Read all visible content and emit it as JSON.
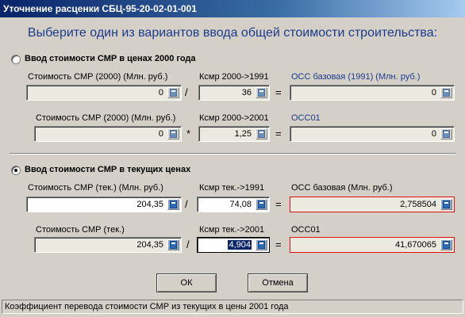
{
  "window": {
    "title": "Уточнение расценки СБЦ-95-20-02-01-001"
  },
  "heading": "Выберите один из вариантов ввода общей стоимости строительства:",
  "option1": {
    "label": "Ввод стоимости СМР в ценах 2000 года",
    "selected": false,
    "row1": {
      "label_a": "Стоимость СМР (2000) (Млн. руб.)",
      "value_a": "0",
      "op": "/",
      "label_b": "Ксмр 2000->1991",
      "value_b": "36",
      "eq": "=",
      "label_c": "ОСС базовая (1991) (Млн. руб.)",
      "value_c": "0"
    },
    "row2": {
      "label_a": "Стоимость СМР (2000) (Млн. руб.)",
      "value_a": "0",
      "op": "*",
      "label_b": "Ксмр 2000->2001",
      "value_b": "1,25",
      "eq": "=",
      "label_c": "ОСС01",
      "value_c": "0"
    }
  },
  "option2": {
    "label": "Ввод стоимости СМР в текущих ценах",
    "selected": true,
    "row1": {
      "label_a": "Стоимость СМР (тек.) (Млн. руб.)",
      "value_a": "204,35",
      "op": "/",
      "label_b": "Ксмр тек.->1991",
      "value_b": "74,08",
      "eq": "=",
      "label_c": "ОСС базовая (Млн. руб.)",
      "value_c": "2,758504"
    },
    "row2": {
      "label_a": "Стоимость СМР (тек.)",
      "value_a": "204,35",
      "op": "/",
      "label_b": "Ксмр тек.->2001",
      "value_b": "4,904",
      "eq": "=",
      "label_c": "ОСС01",
      "value_c": "41,670065"
    }
  },
  "buttons": {
    "ok": "ОК",
    "cancel": "Отмена"
  },
  "status": "Коэффициент перевода стоимости СМР из текущих в цены 2001 года",
  "icons": {
    "field_button": "calculator-icon"
  }
}
